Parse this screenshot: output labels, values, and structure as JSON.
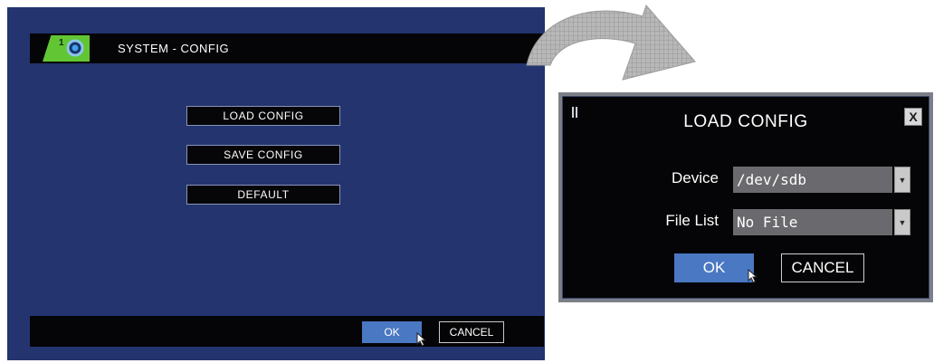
{
  "system_config": {
    "title": "SYSTEM - CONFIG",
    "menu": [
      "LOAD CONFIG",
      "SAVE CONFIG",
      "DEFAULT"
    ],
    "ok_label": "OK",
    "cancel_label": "CANCEL"
  },
  "load_config_dialog": {
    "title": "LOAD CONFIG",
    "close_glyph": "X",
    "device_label": "Device",
    "device_value": "/dev/sdb",
    "file_list_label": "File List",
    "file_list_value": "No File",
    "ok_label": "OK",
    "cancel_label": "CANCEL"
  },
  "colors": {
    "screen_bg": "#23346f",
    "bar_bg": "#050507",
    "ok_button": "#4a78c2",
    "logo_green": "#62c534"
  },
  "icons": {
    "logo": "gear-logo-icon",
    "arrow": "curved-arrow-icon",
    "cursor": "mouse-cursor-icon",
    "close": "close-icon",
    "dropdown": "chevron-down-icon"
  }
}
